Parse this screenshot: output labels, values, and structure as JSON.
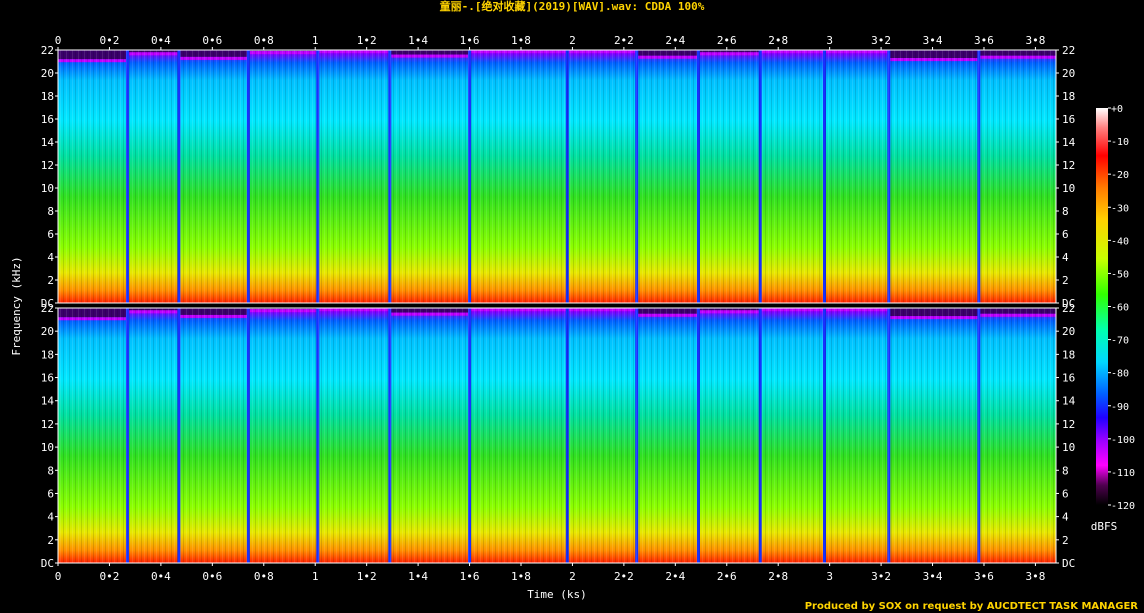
{
  "title": "童丽-.[绝对收藏](2019)[WAV].wav: CDDA 100%",
  "credit": "Produced by SOX on request by AUCDTECT TASK MANAGER",
  "chart_data": {
    "type": "heatmap",
    "title": "童丽-.[绝对收藏](2019)[WAV].wav: CDDA 100%",
    "xlabel": "Time (ks)",
    "ylabel": "Frequency (kHz)",
    "colorbar_label": "dBFS",
    "xlim": [
      0,
      3.88
    ],
    "ylim": [
      0,
      22
    ],
    "x_ticks": [
      "0",
      "0•2",
      "0•4",
      "0•6",
      "0•8",
      "1",
      "1•2",
      "1•4",
      "1•6",
      "1•8",
      "2",
      "2•2",
      "2•4",
      "2•6",
      "2•8",
      "3",
      "3•2",
      "3•4",
      "3•6",
      "3•8"
    ],
    "x_tick_values": [
      0,
      0.2,
      0.4,
      0.6,
      0.8,
      1.0,
      1.2,
      1.4,
      1.6,
      1.8,
      2.0,
      2.2,
      2.4,
      2.6,
      2.8,
      3.0,
      3.2,
      3.4,
      3.6,
      3.8
    ],
    "y_ticks": [
      "DC",
      "2",
      "4",
      "6",
      "8",
      "10",
      "12",
      "14",
      "16",
      "18",
      "20",
      "22"
    ],
    "y_tick_values": [
      0,
      2,
      4,
      6,
      8,
      10,
      12,
      14,
      16,
      18,
      20,
      22
    ],
    "channels": 2,
    "colorbar_ticks": [
      "+0",
      "-10",
      "-20",
      "-30",
      "-40",
      "-50",
      "-60",
      "-70",
      "-80",
      "-90",
      "-100",
      "-110",
      "-120"
    ],
    "colorbar_values": [
      0,
      -10,
      -20,
      -30,
      -40,
      -50,
      -60,
      -70,
      -80,
      -90,
      -100,
      -110,
      -120
    ],
    "colorbar_colors": [
      "#ffffff",
      "#ff3030",
      "#ff0000",
      "#ff7a00",
      "#ffd000",
      "#d8ff00",
      "#30ff00",
      "#00ffb0",
      "#00d8ff",
      "#0060ff",
      "#2000ff",
      "#a000ff",
      "#ff00ff",
      "#500050",
      "#000000"
    ],
    "track_boundaries_ks": [
      0,
      0.27,
      0.47,
      0.74,
      1.01,
      1.29,
      1.6,
      1.98,
      2.25,
      2.49,
      2.73,
      2.98,
      3.23,
      3.58,
      3.88
    ],
    "track_cutoff_khz": [
      21.2,
      21.8,
      21.4,
      21.9,
      22.0,
      21.6,
      22.0,
      22.0,
      21.5,
      21.8,
      22.0,
      22.0,
      21.3,
      21.5
    ]
  }
}
